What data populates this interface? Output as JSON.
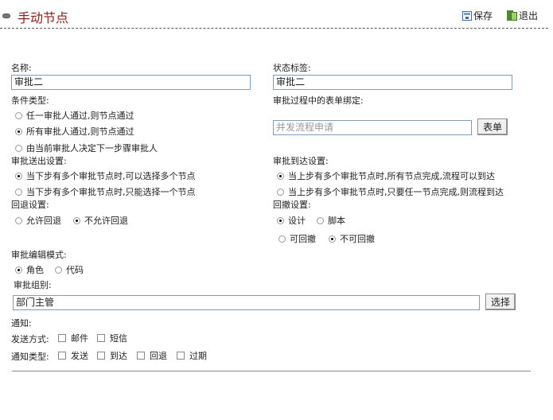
{
  "header": {
    "title": "手动节点",
    "save_label": "保存",
    "exit_label": "退出"
  },
  "name": {
    "label": "名称:",
    "value": "审批二"
  },
  "status_tag": {
    "label": "状态标签:",
    "value": "审批二"
  },
  "condition_type": {
    "label": "条件类型:",
    "options": [
      "任一审批人通过,则节点通过",
      "所有审批人通过,则节点通过",
      "由当前审批人决定下一步骤审批人"
    ],
    "selected": 1
  },
  "form_binding": {
    "label": "审批过程中的表单绑定:",
    "placeholder": "并发流程申请",
    "button": "表单"
  },
  "send_setting": {
    "label": "审批送出设置:",
    "options": [
      "当下步有多个审批节点时,可以选择多个节点",
      "当下步有多个审批节点时,只能选择一个节点"
    ],
    "selected": 0
  },
  "arrival_setting": {
    "label": "审批到达设置:",
    "options": [
      "当上步有多个审批节点时,所有节点完成,流程可以到达",
      "当上步有多个审批节点时,只要任一节点完成,则流程到达"
    ],
    "selected": 0
  },
  "rollback_setting": {
    "label": "回退设置:",
    "options": [
      "允许回退",
      "不允许回退"
    ],
    "selected": 1
  },
  "revoke_setting": {
    "label": "回撤设置:",
    "options_a": [
      "设计",
      "脚本"
    ],
    "selected_a": 0,
    "options_b": [
      "可回撤",
      "不可回撤"
    ],
    "selected_b": 1
  },
  "edit_mode": {
    "label": "审批编辑模式:",
    "options": [
      "角色",
      "代码"
    ],
    "selected": 0
  },
  "approval_group": {
    "label": "审批组别:",
    "value": "部门主管",
    "button": "选择"
  },
  "notify": {
    "label": "通知:",
    "send_method_label": "发送方式:",
    "send_methods": [
      "邮件",
      "短信"
    ],
    "notify_type_label": "通知类型:",
    "notify_types": [
      "发送",
      "到达",
      "回退",
      "过期"
    ]
  }
}
